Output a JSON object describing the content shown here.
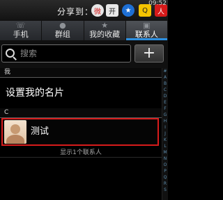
{
  "share": {
    "label": "分享到：",
    "icons": [
      "weibo-icon",
      "kaixin-icon",
      "qzone-icon",
      "qq-icon",
      "renren-icon"
    ]
  },
  "status": {
    "time": "09:52"
  },
  "tabs": [
    {
      "label": "手机",
      "icon": "phone-icon",
      "active": false
    },
    {
      "label": "群组",
      "icon": "group-icon",
      "active": false
    },
    {
      "label": "我的收藏",
      "icon": "star-icon",
      "active": false
    },
    {
      "label": "联系人",
      "icon": "contacts-icon",
      "active": true
    }
  ],
  "search": {
    "placeholder": "搜索",
    "value": "",
    "add_label": "+"
  },
  "list": {
    "me_header": "我",
    "my_profile": "设置我的名片",
    "c_header": "C",
    "contacts": [
      {
        "name": "测试"
      }
    ],
    "count_text": "显示1个联系人"
  },
  "index_bar": [
    "#",
    "A",
    "B",
    "C",
    "D",
    "E",
    "F",
    "G",
    "H",
    "I",
    "J",
    "K",
    "L",
    "M",
    "N",
    "O",
    "P",
    "Q",
    "R",
    "S"
  ],
  "colors": {
    "accent": "#2d8fe0",
    "highlight": "#d91c1c"
  }
}
